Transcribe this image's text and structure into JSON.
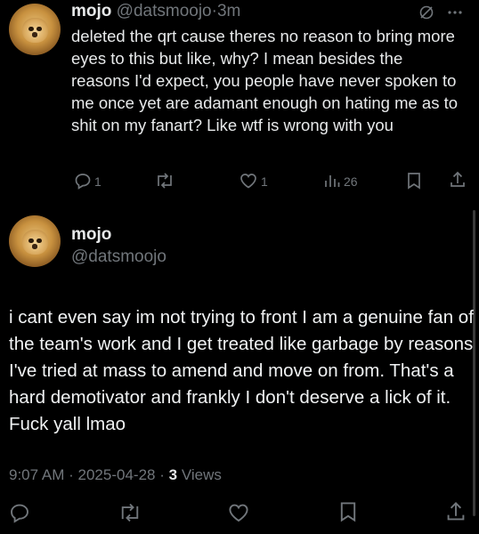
{
  "reply_tweet": {
    "display_name": "mojo",
    "handle": "@datsmoojo",
    "separator": "·",
    "time": "3m",
    "text": "deleted the qrt cause theres no reason to bring more eyes to this but like, why? I mean besides the reasons I'd expect, you people have never spoken to me once yet are adamant enough on hating me as to shit on my fanart? Like wtf is wrong with you",
    "actions": {
      "reply_count": "1",
      "like_count": "1",
      "views_count": "26"
    }
  },
  "main_tweet": {
    "display_name": "mojo",
    "handle": "@datsmoojo",
    "text": "i cant even say im not trying to front  I am a genuine fan of the team's work and I get treated like garbage by reasons I've tried at mass to amend and move on from. That's a hard demotivator and frankly I don't deserve a lick of it. Fuck yall lmao",
    "meta": {
      "time": "9:07 AM",
      "dot1": "·",
      "date": "2025-04-28",
      "dot2": "·",
      "views_number": "3",
      "views_label": "Views"
    }
  },
  "icons": [
    "grok-icon",
    "more-icon",
    "reply-icon",
    "retweet-icon",
    "like-icon",
    "views-icon",
    "bookmark-icon",
    "share-icon"
  ],
  "colors": {
    "background": "#000000",
    "text": "#e7e9ea",
    "muted": "#71767b"
  }
}
